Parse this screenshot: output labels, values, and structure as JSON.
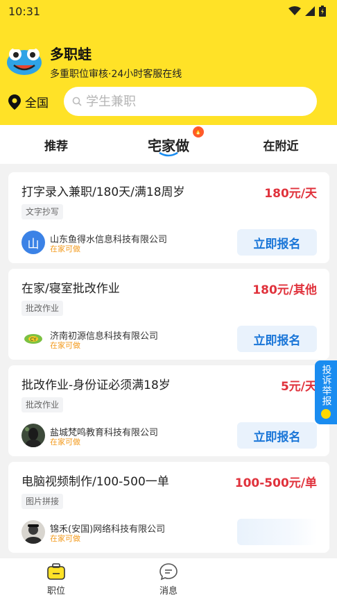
{
  "status": {
    "time": "10:31"
  },
  "app": {
    "name": "多职蛙",
    "slogan": "多重职位审核·24小时客服在线",
    "logo_text": "多职蛙"
  },
  "location": {
    "label": "全国"
  },
  "search": {
    "placeholder": "学生兼职"
  },
  "tabs": [
    {
      "label": "推荐",
      "active": false
    },
    {
      "label": "宅家做",
      "active": true
    },
    {
      "label": "在附近",
      "active": false
    }
  ],
  "jobs": [
    {
      "title": "打字录入兼职/180天/满18周岁",
      "salary": "180元/天",
      "tag": "文字抄写",
      "company": "山东鱼得水信息科技有限公司",
      "note": "在家可做",
      "avatar_char": "山",
      "apply_label": "立即报名"
    },
    {
      "title": "在家/寝室批改作业",
      "salary": "180元/其他",
      "tag": "批改作业",
      "company": "济南初源信息科技有限公司",
      "note": "在家可做",
      "avatar_char": "",
      "apply_label": "立即报名"
    },
    {
      "title": "批改作业-身份证必须满18岁",
      "salary": "5元/天",
      "tag": "批改作业",
      "company": "盐城梵鸣教育科技有限公司",
      "note": "在家可做",
      "avatar_char": "",
      "apply_label": "立即报名"
    },
    {
      "title": "电脑视频制作/100-500一单",
      "salary": "100-500元/单",
      "tag": "图片拼接",
      "company": "锦禾(安国)网络科技有限公司",
      "note": "在家可做",
      "avatar_char": "",
      "apply_label": ""
    }
  ],
  "report": {
    "label": "投诉举报"
  },
  "bottom_nav": [
    {
      "label": "职位",
      "icon": "briefcase-icon",
      "active": true
    },
    {
      "label": "消息",
      "icon": "message-icon",
      "active": false
    }
  ],
  "colors": {
    "brand": "#ffe227",
    "salary": "#e0323c",
    "apply_bg": "#e9f2fc",
    "apply_text": "#1a76d8",
    "note": "#f39a1c"
  }
}
